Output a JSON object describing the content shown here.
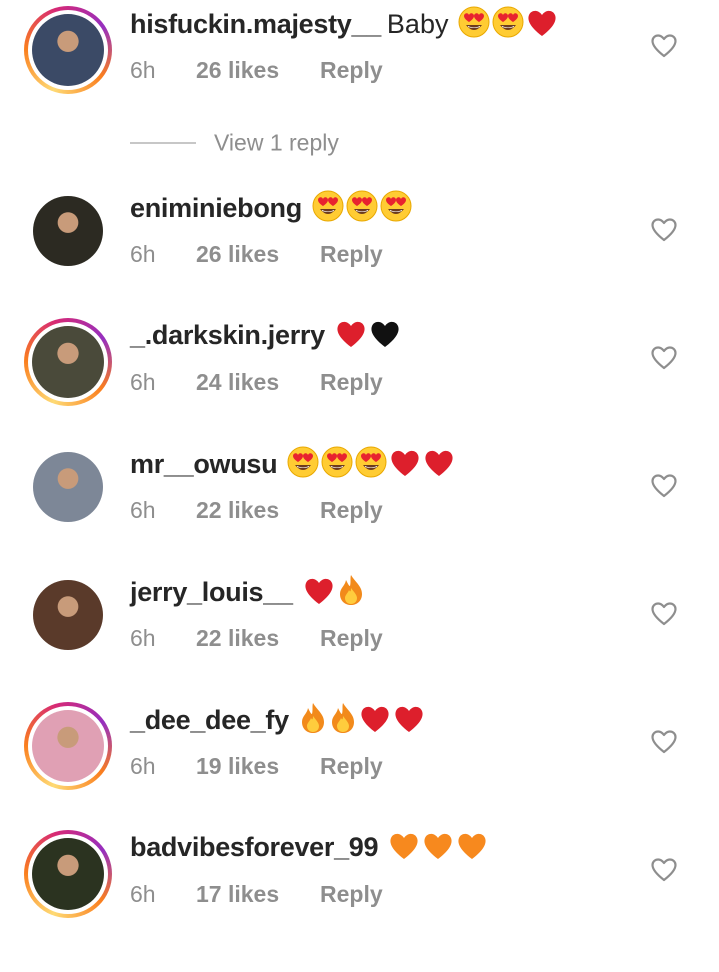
{
  "comments": [
    {
      "username": "hisfuckin.majesty__",
      "text": "Baby",
      "emojis": [
        "heart-eyes",
        "heart-eyes",
        "red-heart"
      ],
      "time": "6h",
      "likes": "26 likes",
      "reply": "Reply",
      "story_ring": true,
      "avatar_color": "#3b4a66",
      "view_replies": "View 1 reply"
    },
    {
      "username": "eniminiebong",
      "text": "",
      "emojis": [
        "heart-eyes",
        "heart-eyes",
        "heart-eyes"
      ],
      "time": "6h",
      "likes": "26 likes",
      "reply": "Reply",
      "story_ring": false,
      "avatar_color": "#2c2a22"
    },
    {
      "username": "_.darkskin.jerry",
      "text": "",
      "emojis": [
        "red-heart",
        "black-heart"
      ],
      "time": "6h",
      "likes": "24 likes",
      "reply": "Reply",
      "story_ring": true,
      "avatar_color": "#4a4a3a"
    },
    {
      "username": "mr__owusu",
      "text": "",
      "emojis": [
        "heart-eyes",
        "heart-eyes",
        "heart-eyes",
        "red-heart",
        "red-heart"
      ],
      "time": "6h",
      "likes": "22 likes",
      "reply": "Reply",
      "story_ring": false,
      "avatar_color": "#7d8797"
    },
    {
      "username": "jerry_louis__",
      "text": "",
      "emojis": [
        "red-heart",
        "fire"
      ],
      "time": "6h",
      "likes": "22 likes",
      "reply": "Reply",
      "story_ring": false,
      "avatar_color": "#5a3a2a"
    },
    {
      "username": "_dee_dee_fy",
      "text": "",
      "emojis": [
        "fire",
        "fire",
        "red-heart",
        "red-heart"
      ],
      "time": "6h",
      "likes": "19 likes",
      "reply": "Reply",
      "story_ring": true,
      "avatar_color": "#e0a0b4"
    },
    {
      "username": "badvibesforever_99",
      "text": "",
      "emojis": [
        "orange-heart",
        "orange-heart",
        "orange-heart"
      ],
      "time": "6h",
      "likes": "17 likes",
      "reply": "Reply",
      "story_ring": true,
      "avatar_color": "#2b3320"
    }
  ],
  "icons": {
    "like": "heart-outline-icon"
  },
  "colors": {
    "text_primary": "#262626",
    "text_secondary": "#8e8e8e",
    "story_ring_start": "#feda75",
    "story_ring_end": "#d62976"
  }
}
